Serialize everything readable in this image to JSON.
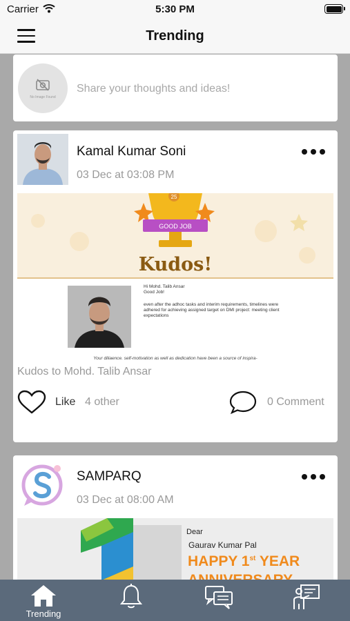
{
  "status_bar": {
    "carrier": "Carrier",
    "time": "5:30 PM"
  },
  "nav": {
    "title": "Trending"
  },
  "composer": {
    "no_image_text": "No Image Found",
    "placeholder": "Share your thoughts and ideas!"
  },
  "posts": [
    {
      "author": "Kamal Kumar Soni",
      "time": "03 Dec at 03:08 PM",
      "image": {
        "badge_number": "25",
        "ribbon": "GOOD JOB",
        "title": "Kudos!",
        "greeting_1": "Hi Mohd. Talib Ansar",
        "greeting_2": "Good Job!",
        "message": "even after the adhoc tasks and interim requirements,  timelines were adhered for achieving assigned target on DMI project: meeting client expectations",
        "footer": "Your diliaence. self-motivation as well as dedication have been a source of inspira-"
      },
      "caption": "Kudos to Mohd. Talib Ansar",
      "like_label": "Like",
      "like_count": "4 other",
      "comment_count": "0 Comment"
    },
    {
      "author": "SAMPARQ",
      "time": "03 Dec at 08:00 AM",
      "image": {
        "dear": "Dear",
        "name": "Gaurav Kumar Pal",
        "headline_1": "HAPPY 1",
        "headline_sup": "st",
        "headline_2": " YEAR",
        "subline": "ANNIVERSARY"
      }
    }
  ],
  "tabs": [
    {
      "label": "Trending",
      "icon": "home-icon"
    },
    {
      "label": "",
      "icon": "bell-icon"
    },
    {
      "label": "",
      "icon": "chat-icon"
    },
    {
      "label": "",
      "icon": "presentation-icon"
    }
  ],
  "colors": {
    "background": "#a9a9a9",
    "tab_bar": "#5b6a7b",
    "accent_orange": "#f08a1c",
    "ribbon_purple": "#b84fc4"
  }
}
